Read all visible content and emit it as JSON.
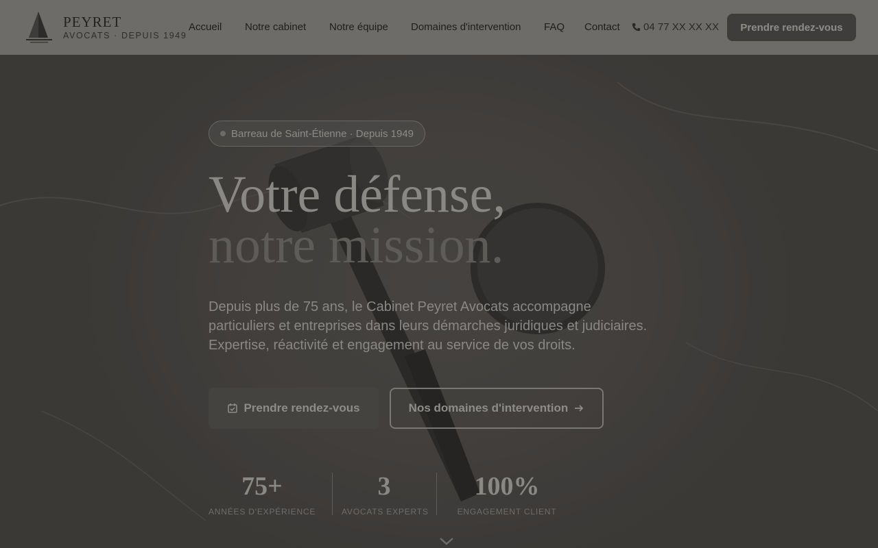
{
  "brand": {
    "name": "PEYRET",
    "subtitle": "AVOCATS · DEPUIS 1949"
  },
  "nav": {
    "items": [
      {
        "label": "Accueil"
      },
      {
        "label": "Notre cabinet"
      },
      {
        "label": "Notre équipe"
      },
      {
        "label": "Domaines d'intervention"
      },
      {
        "label": "FAQ"
      },
      {
        "label": "Contact"
      }
    ],
    "phone": "04 77 XX XX XX",
    "cta": "Prendre rendez-vous"
  },
  "hero": {
    "badge": "Barreau de Saint-Étienne · Depuis 1949",
    "title_line1": "Votre défense,",
    "title_line2": "notre mission.",
    "description": "Depuis plus de 75 ans, le Cabinet Peyret Avocats accompagne particuliers et entreprises dans leurs démarches juridiques et judiciaires. Expertise, réactivité et engagement au service de vos droits.",
    "primary_button": "Prendre rendez-vous",
    "secondary_button": "Nos domaines d'intervention"
  },
  "stats": [
    {
      "value": "75+",
      "label": "ANNÉES D'EXPÉRIENCE"
    },
    {
      "value": "3",
      "label": "AVOCATS EXPERTS"
    },
    {
      "value": "100%",
      "label": "ENGAGEMENT CLIENT"
    }
  ],
  "icons": {
    "logo": "sail-logo-icon",
    "phone": "phone-icon",
    "calendar": "calendar-check-icon",
    "arrow": "arrow-right-icon",
    "scroll": "chevron-down-icon"
  },
  "colors": {
    "header_bg": "#6e6c69",
    "cta_bg": "#3e3d3b",
    "hero_bg": "#4a4845"
  }
}
